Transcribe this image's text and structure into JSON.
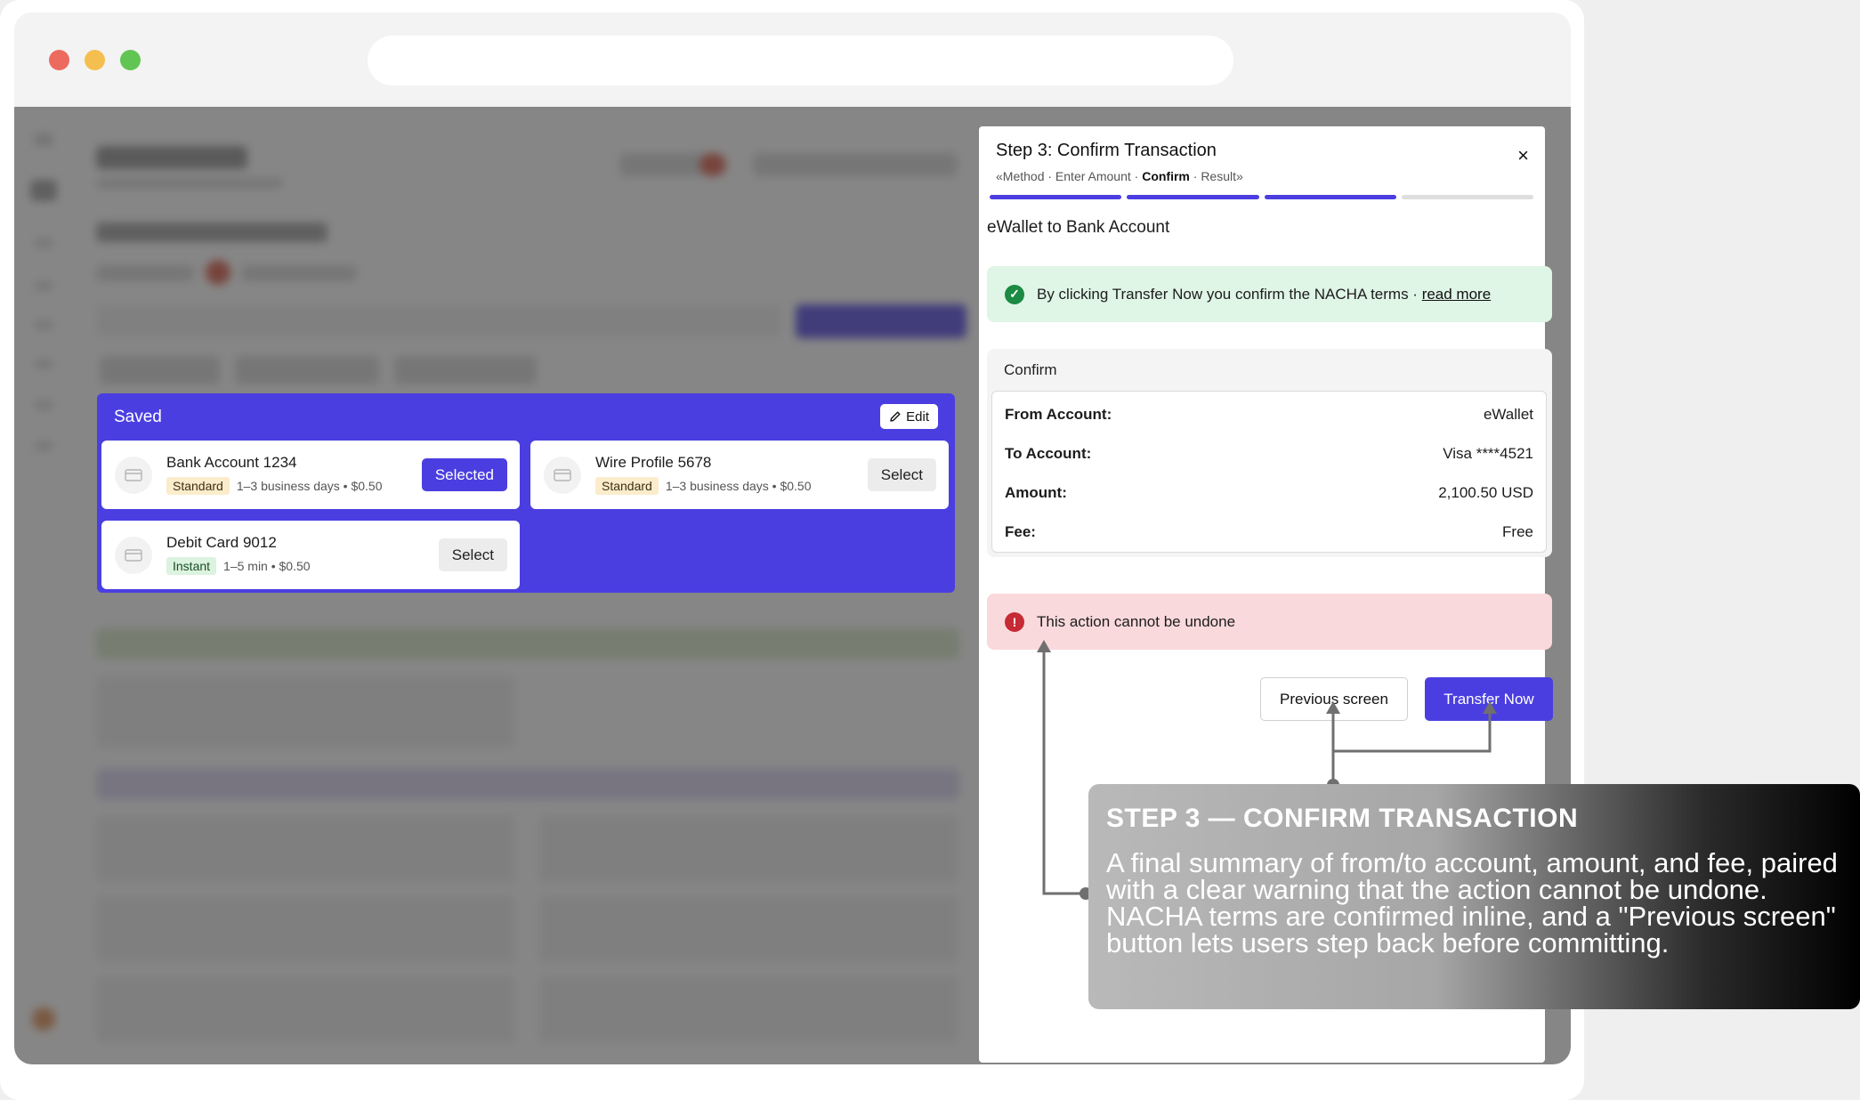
{
  "saved": {
    "title": "Saved",
    "edit_label": "Edit",
    "cards": [
      {
        "name": "Bank Account 1234",
        "tag": "Standard",
        "meta": "1–3 business days • $0.50",
        "button": "Selected"
      },
      {
        "name": "Wire Profile 5678",
        "tag": "Standard",
        "meta": "1–3 business days • $0.50",
        "button": "Select"
      },
      {
        "name": "Debit Card 9012",
        "tag": "Instant",
        "meta": "1–5 min • $0.50",
        "button": "Select"
      }
    ]
  },
  "modal": {
    "title": "Step 3: Confirm Transaction",
    "close_icon": "×",
    "crumb_prefix": "«Method · Enter Amount · ",
    "crumb_current": "Confirm",
    "crumb_suffix": " · Result»",
    "progress_steps_completed": 3,
    "progress_steps_total": 4,
    "subtitle": "eWallet to Bank Account",
    "notice_text": "By clicking Transfer Now you confirm the NACHA terms · ",
    "notice_link": "read more",
    "confirm_title": "Confirm",
    "rows": [
      {
        "label": "From Account:",
        "value": "eWallet"
      },
      {
        "label": "To Account:",
        "value": "Visa ****4521"
      },
      {
        "label": "Amount:",
        "value": "2,100.50 USD"
      },
      {
        "label": "Fee:",
        "value": "Free"
      }
    ],
    "warning_text": "This action cannot be undone",
    "previous_label": "Previous screen",
    "transfer_label": "Transfer Now"
  },
  "callout": {
    "heading": "STEP 3 — CONFIRM TRANSACTION",
    "body": "A final summary of from/to account, amount, and fee, paired with a clear warning that the action cannot be undone. NACHA terms are confirmed inline, and a \"Previous screen\" button lets users step back before committing."
  },
  "colors": {
    "accent": "#4b3ee0",
    "success": "#1b8a43",
    "danger": "#c62a35"
  }
}
